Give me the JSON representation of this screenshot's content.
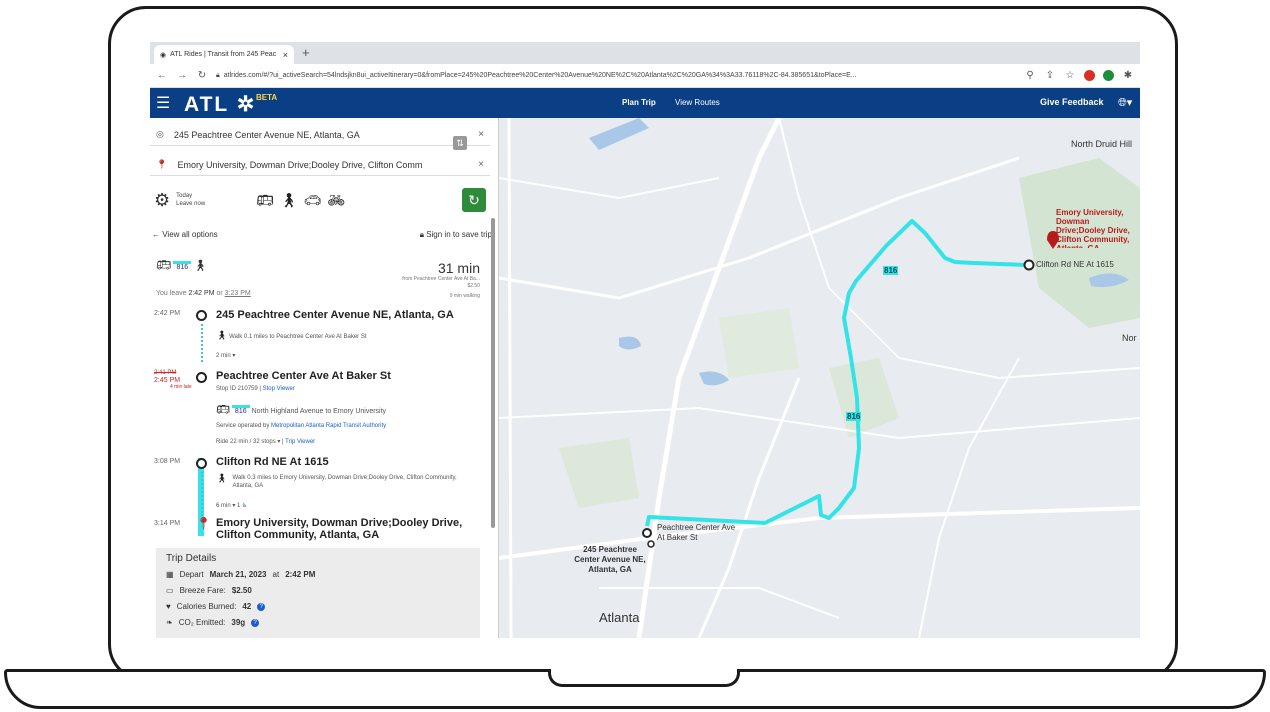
{
  "browser": {
    "tab_title": "ATL Rides | Transit from 245 Peac",
    "new_tab": "+",
    "url": "atlrides.com/#/?ui_activeSearch=54lndsjkn8ui_activeItinerary=0&fromPlace=245%20Peachtree%20Center%20Avenue%20NE%2C%20Atlanta%2C%20GA%34%3A33.76118%2C-84.385651&toPlace=E..."
  },
  "header": {
    "logo": "ATL",
    "logo_mark": "✲",
    "beta": "BETA",
    "nav_plan": "Plan Trip",
    "nav_routes": "View Routes",
    "feedback": "Give Feedback"
  },
  "search": {
    "from": "245 Peachtree Center Avenue NE, Atlanta, GA",
    "to": "Emory University, Dowman Drive;Dooley Drive, Clifton Comm",
    "when_day": "Today",
    "when_mode": "Leave now",
    "view_all": "View all options",
    "sign_in": "Sign in to save trip"
  },
  "itinerary": {
    "route": "816",
    "duration": "31 min",
    "from_note": "from Peachtree Center Ave At Ba...",
    "fare": "$2.50",
    "leave_prefix": "You leave",
    "leave_time": "2:42 PM",
    "leave_or": "or",
    "alt_time": "3:23 PM",
    "walking": "9 min walking",
    "steps": [
      {
        "time": "2:42 PM",
        "title": "245 Peachtree Center Avenue NE, Atlanta, GA"
      },
      {
        "time_old": "2:41 PM",
        "time": "2:45 PM",
        "late": "4 min late",
        "title": "Peachtree Center Ave At Baker St"
      },
      {
        "time": "3:08 PM",
        "title": "Clifton Rd NE At 1615"
      },
      {
        "time": "3:14 PM",
        "title": "Emory University, Dowman Drive;Dooley Drive, Clifton Community, Atlanta, GA"
      }
    ],
    "walk1": "Walk 0.1 miles to Peachtree Center Ave At Baker St",
    "walk1_dur": "2 min",
    "stop_id": "Stop ID 210759 |",
    "stop_viewer": "Stop Viewer",
    "bus_desc": "North Highland Avenue to Emory University",
    "operator_prefix": "Service operated by",
    "operator": "Metropolitan Atlanta Rapid Transit Authority",
    "ride": "Ride 22 min / 32 stops",
    "trip_viewer": "Trip Viewer",
    "walk2": "Walk 0.3 miles to Emory University, Dowman Drive;Dooley Drive, Clifton Community, Atlanta, GA",
    "walk2_dur": "6 min",
    "walk2_count": "1"
  },
  "details": {
    "title": "Trip Details",
    "depart_prefix": "Depart",
    "depart_date": "March 21, 2023",
    "depart_at": "at",
    "depart_time": "2:42 PM",
    "fare_label": "Breeze Fare:",
    "fare": "$2.50",
    "calories_label": "Calories Burned:",
    "calories": "42",
    "co2_label": "CO₂ Emitted:",
    "co2": "39g"
  },
  "map": {
    "north_druid": "North Druid Hill",
    "emory_label": "Emory University, Dowman Drive;Dooley Drive, Clifton Community, Atlanta, GA",
    "clifton": "Clifton Rd NE At 1615",
    "route_label": "816",
    "peachtree_stop": "Peachtree Center Ave At Baker St",
    "origin": "245 Peachtree Center Avenue NE, Atlanta, GA",
    "atlanta": "Atlanta",
    "nor": "Nor",
    "road_colors": {
      "route": "#33e3e8",
      "water": "#a9c7e6",
      "park": "#cfe3cf",
      "road": "#ffffff"
    }
  }
}
